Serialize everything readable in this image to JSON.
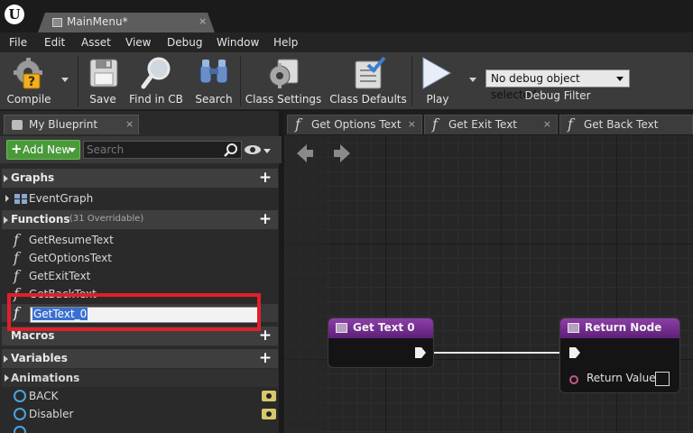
{
  "window": {
    "logo": "U",
    "doc_tab": "MainMenu*",
    "doc_tab_close": "×"
  },
  "menu": [
    "File",
    "Edit",
    "Asset",
    "View",
    "Debug",
    "Window",
    "Help"
  ],
  "toolbar": {
    "compile": "Compile",
    "save": "Save",
    "find_in_cb": "Find in CB",
    "search": "Search",
    "class_settings": "Class Settings",
    "class_defaults": "Class Defaults",
    "play": "Play",
    "debug_object": "No debug object selected",
    "debug_filter": "Debug Filter"
  },
  "my_blueprint": {
    "tab_label": "My Blueprint",
    "tab_close": "×",
    "add_new": "Add New",
    "search_placeholder": "Search",
    "sections": {
      "graphs": "Graphs",
      "functions": "Functions",
      "functions_sub": "(31 Overridable)",
      "macros": "Macros",
      "variables": "Variables",
      "animations": "Animations"
    },
    "graphs": [
      "EventGraph"
    ],
    "functions": [
      "GetResumeText",
      "GetOptionsText",
      "GetExitText",
      "GetBackText"
    ],
    "rename_value": "GetText_0",
    "variables": [
      "BACK",
      "Disabler"
    ]
  },
  "graph_tabs": [
    {
      "label": "Get Options Text",
      "close": "×"
    },
    {
      "label": "Get Exit Text",
      "close": "×"
    },
    {
      "label": "Get Back Text",
      "close": ""
    }
  ],
  "nodes": {
    "entry_title": "Get Text 0",
    "return_title": "Return Node",
    "return_value": "Return Value"
  },
  "colors": {
    "accent_green": "#4a9a3a",
    "node_header": "#8d3fa8",
    "highlight": "#e0202a",
    "variable_pin": "#4aa3e0",
    "return_pin": "#c35a8a"
  }
}
